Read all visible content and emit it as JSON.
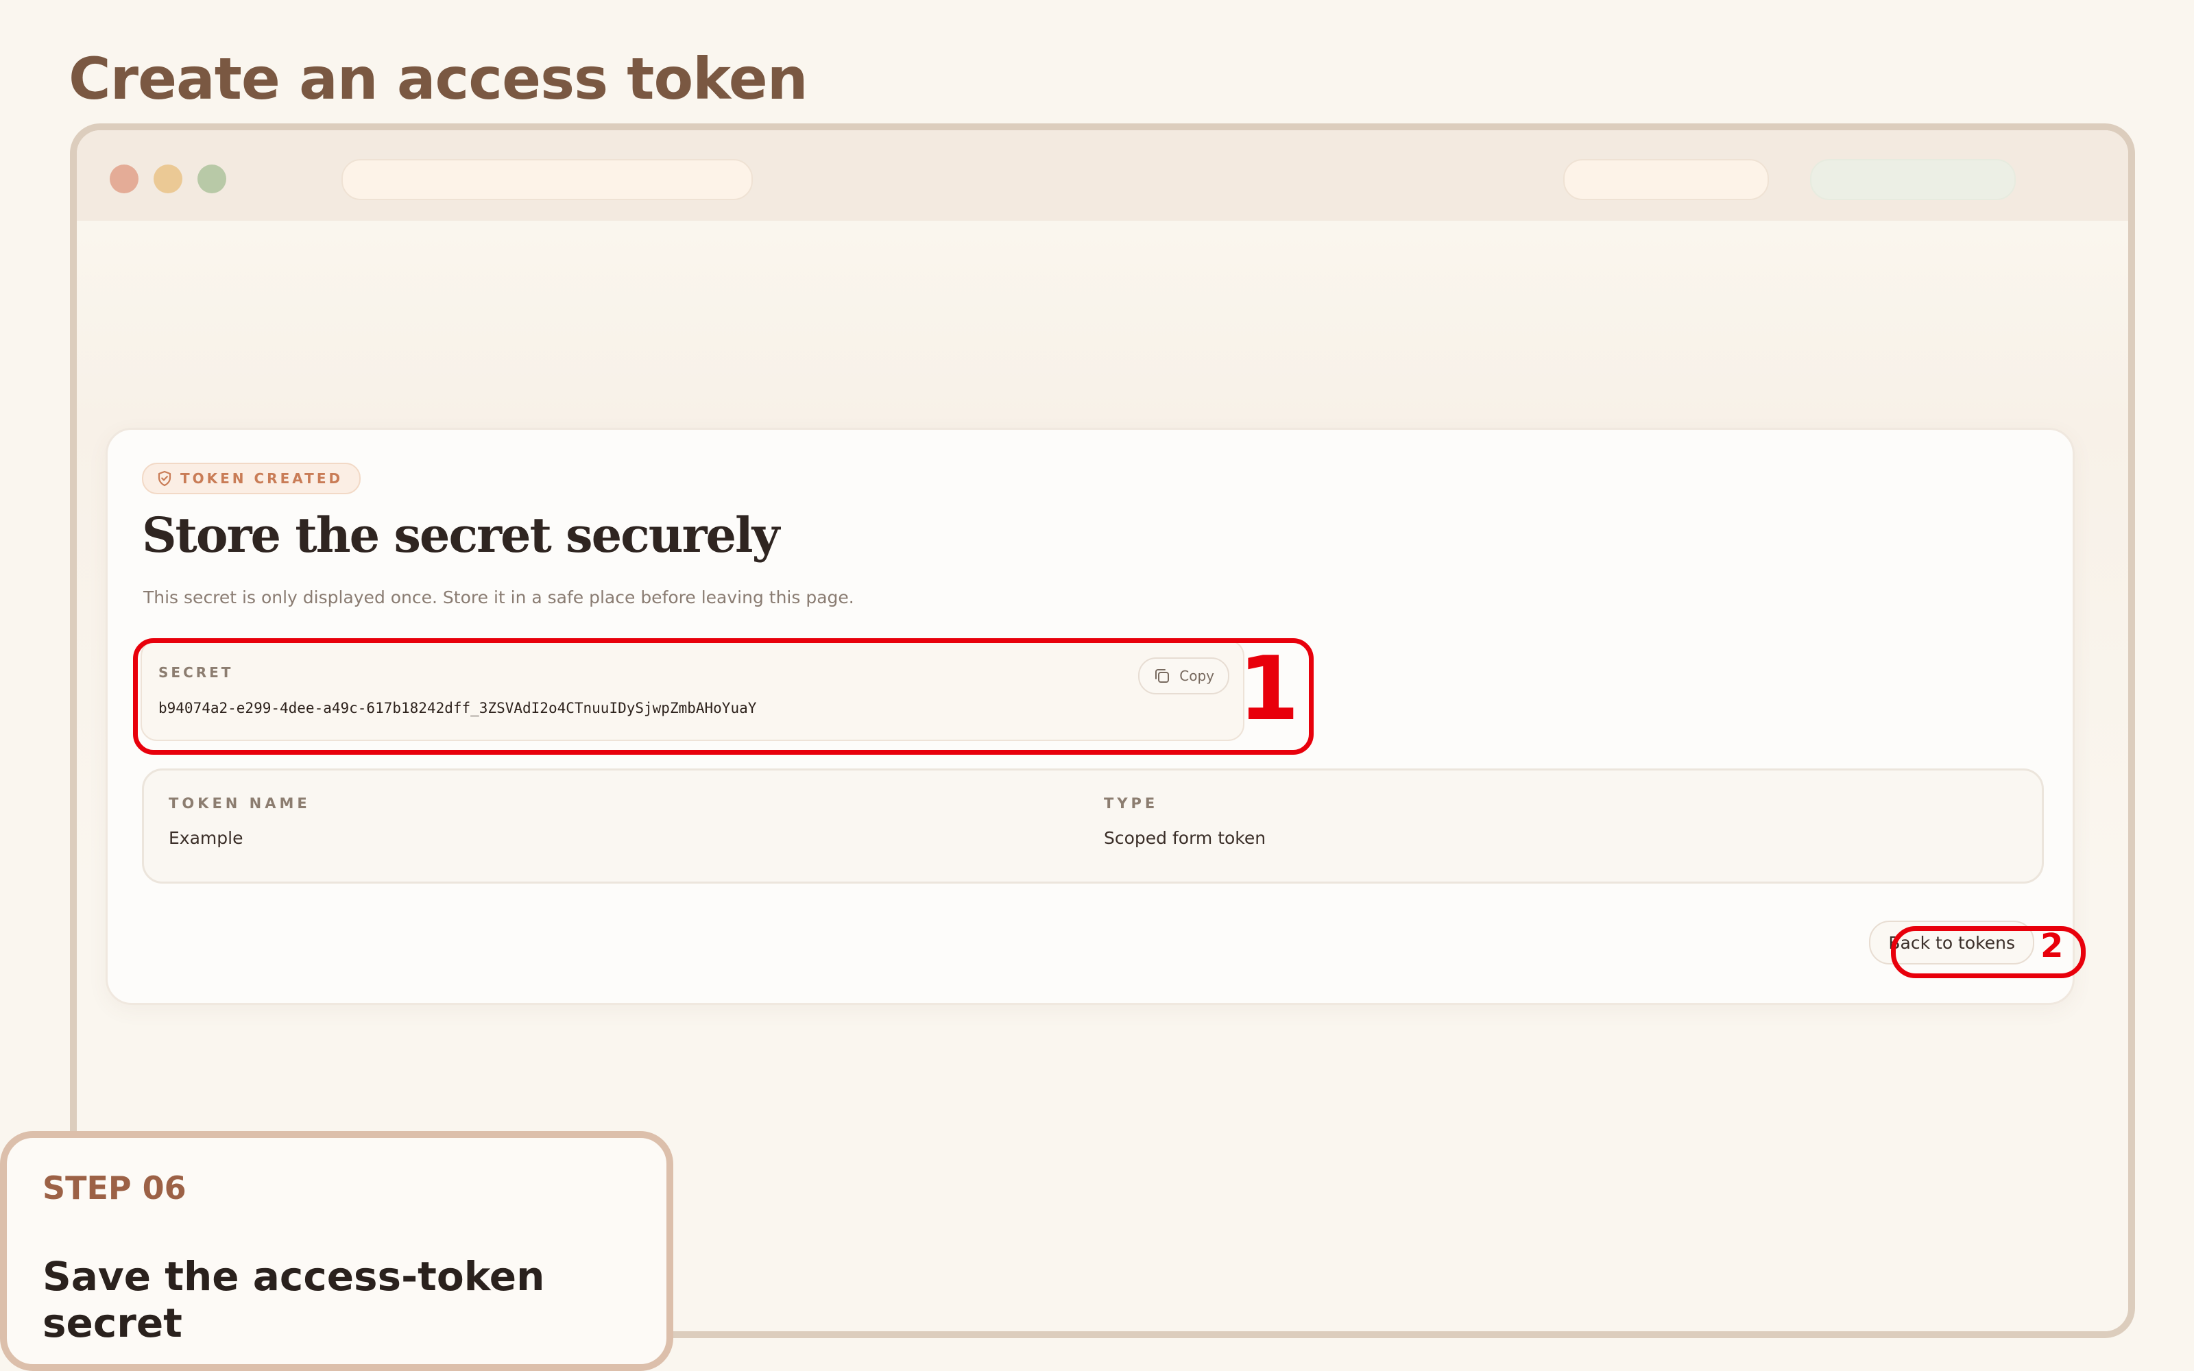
{
  "page": {
    "title": "Create an access token"
  },
  "card": {
    "badge": "TOKEN CREATED",
    "heading": "Store the secret securely",
    "description": "This secret is only displayed once. Store it in a safe place before leaving this page.",
    "secret": {
      "label": "SECRET",
      "value": "b94074a2-e299-4dee-a49c-617b18242dff_3ZSVAdI2o4CTnuuIDySjwpZmbAHoYuaY",
      "copy_label": "Copy"
    },
    "details": {
      "token_name_label": "TOKEN NAME",
      "token_name_value": "Example",
      "type_label": "TYPE",
      "type_value": "Scoped form token"
    },
    "back_label": "Back to tokens"
  },
  "annotations": {
    "callout_1": "1",
    "callout_2": "2"
  },
  "step": {
    "label": "STEP 06",
    "text": "Save the access-token secret"
  },
  "colors": {
    "annotation_red": "#e8000b",
    "accent_brown": "#9c6146",
    "badge_orange": "#c97c56"
  },
  "icons": {
    "badge": "shield-check-icon",
    "copy": "copy-icon"
  }
}
